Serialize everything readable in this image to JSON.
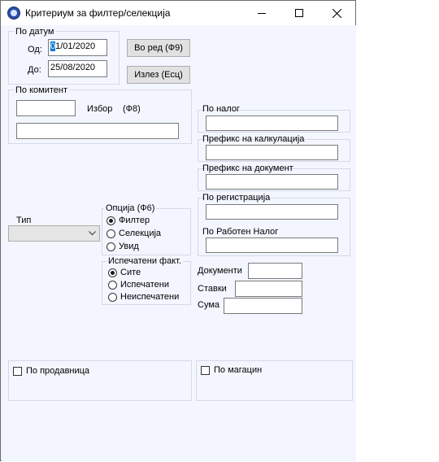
{
  "window": {
    "title": "Критериум за филтер/селекција"
  },
  "date_group": {
    "label": "По датум",
    "from_label": "Од:",
    "from_value_sel": "0",
    "from_value_rest": "1/01/2020",
    "to_label": "До:",
    "to_value": "25/08/2020"
  },
  "buttons": {
    "in_order": "Во ред (Ф9)",
    "exit": "Излез (Есц)"
  },
  "client_group": {
    "label": "По комитент",
    "choose_label": "Избор",
    "choose_key": "(Ф8)",
    "code_value": "",
    "name_value": ""
  },
  "right_fields": {
    "po_nalog": {
      "label": "По налог",
      "value": ""
    },
    "prefix_calc": {
      "label": "Префикс на калкулација",
      "value": ""
    },
    "prefix_doc": {
      "label": "Префикс на документ",
      "value": ""
    },
    "po_registracija": {
      "label": "По регистрација",
      "value": ""
    },
    "po_raboten_nalog": {
      "label": "По Работен Налог",
      "value": ""
    }
  },
  "type": {
    "label": "Тип",
    "value": ""
  },
  "option_group": {
    "label": "Опција (Ф6)",
    "options": [
      "Филтер",
      "Селекција",
      "Увид"
    ],
    "selected": "Филтер"
  },
  "printed_group": {
    "label": "Испечатени факт.",
    "options": [
      "Сите",
      "Испечатени",
      "Неиспечатени"
    ],
    "selected": "Сите"
  },
  "counts": {
    "documents_label": "Документи",
    "documents_value": "",
    "items_label": "Ставки",
    "items_value": "",
    "sum_label": "Сума",
    "sum_value": ""
  },
  "checks": {
    "by_store": "По продавница",
    "by_warehouse": "По магацин"
  }
}
